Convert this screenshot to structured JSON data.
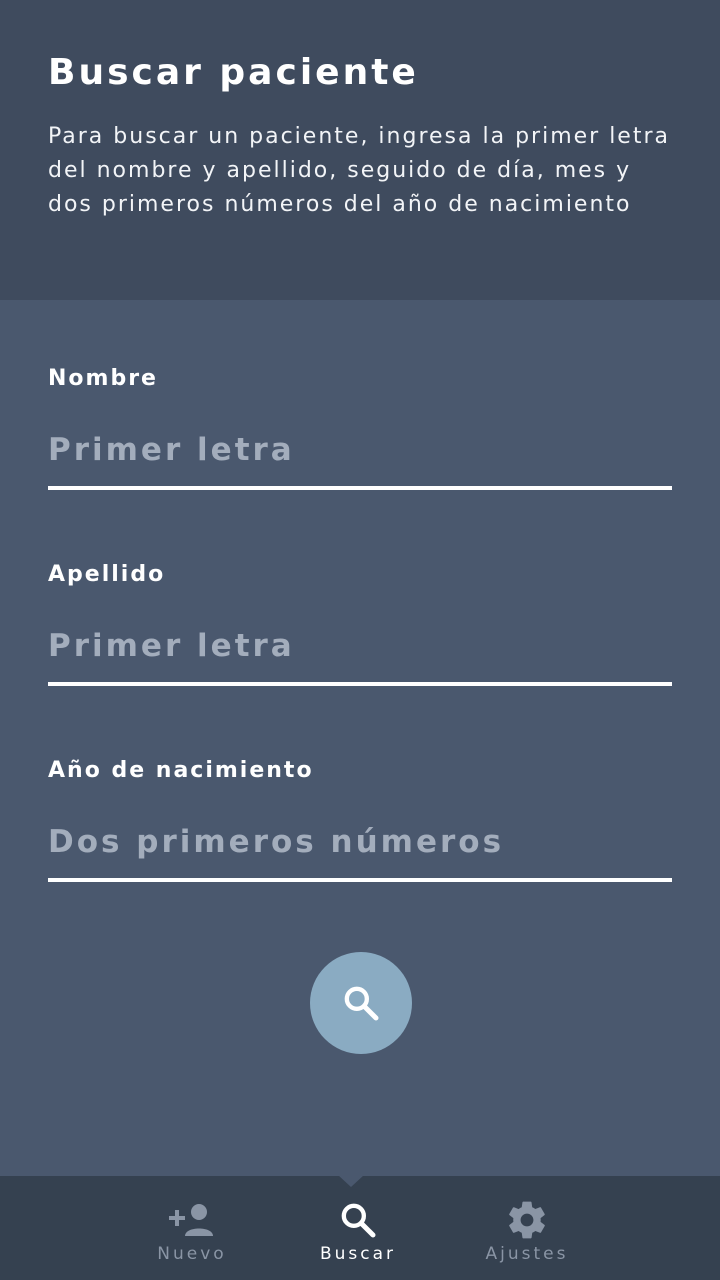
{
  "header": {
    "title": "Buscar paciente",
    "instructions": "Para buscar un paciente, ingresa la primer letra del nombre y apellido, seguido de día, mes y dos primeros números del año de nacimiento"
  },
  "form": {
    "fields": [
      {
        "label": "Nombre",
        "placeholder": "Primer letra",
        "value": ""
      },
      {
        "label": "Apellido",
        "placeholder": "Primer letra",
        "value": ""
      },
      {
        "label": "Año de nacimiento",
        "placeholder": "Dos primeros números",
        "value": ""
      }
    ],
    "submit_icon": "search-icon"
  },
  "bottom_nav": {
    "active": "Buscar",
    "items": [
      {
        "label": "Nuevo",
        "icon": "add-person-icon"
      },
      {
        "label": "Buscar",
        "icon": "search-icon"
      },
      {
        "label": "Ajustes",
        "icon": "gear-icon"
      }
    ]
  },
  "colors": {
    "header_bg": "#3f4b5e",
    "body_bg": "#4a586e",
    "nav_bg": "#354150",
    "fab_bg": "#8aabc2",
    "placeholder": "#a3adbc",
    "nav_inactive": "#8a95a5"
  }
}
